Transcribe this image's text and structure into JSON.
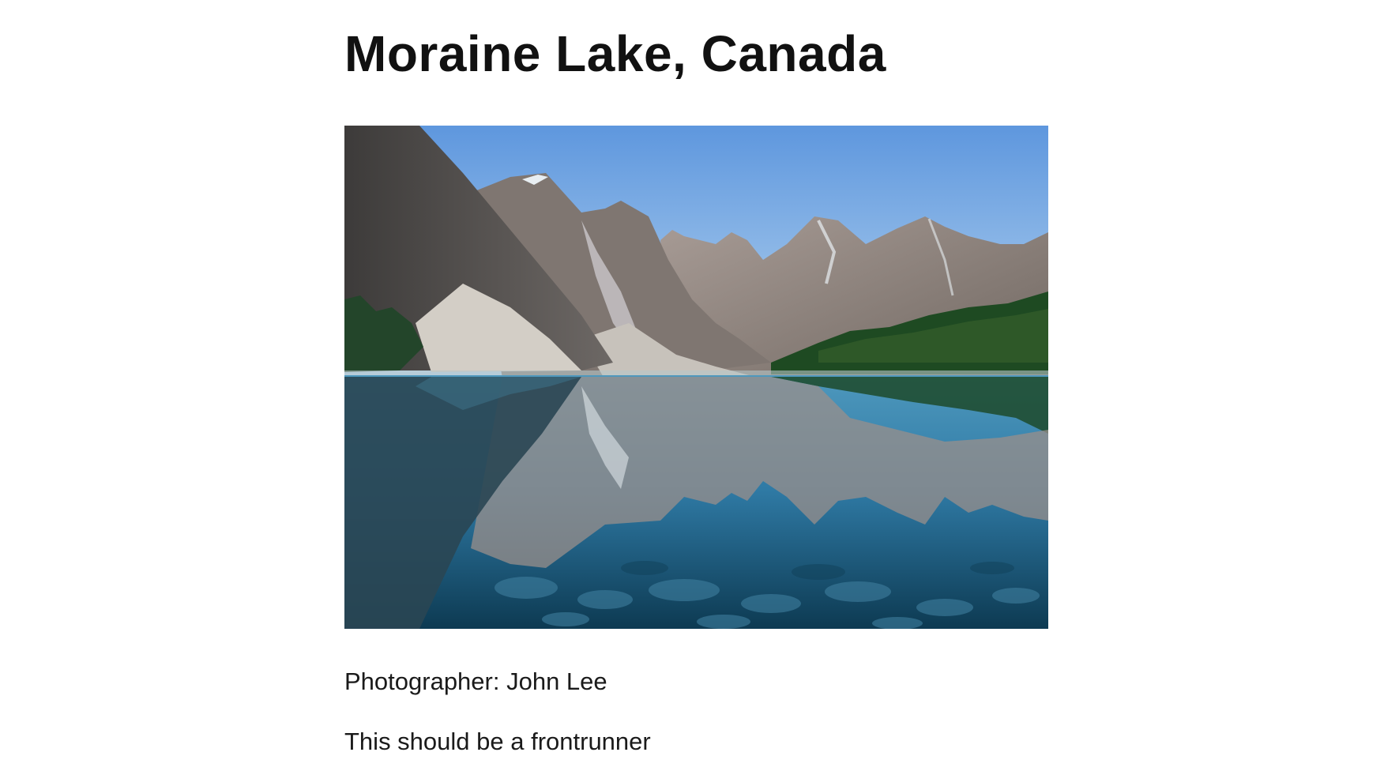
{
  "entry": {
    "title": "Moraine Lake, Canada",
    "photo": {
      "alt": "Moraine Lake, Canada",
      "subject": "mountains-reflected-in-lake"
    },
    "photographer_line": "Photographer: John Lee",
    "comment": "This should be a frontrunner"
  },
  "colors": {
    "sky_top": "#5e97de",
    "sky_bottom": "#b9d6ef",
    "lake_top": "#3f8fb5",
    "lake_bottom": "#0d3a52",
    "forest": "#1e4a22",
    "rock": "#8f7f74",
    "snow": "#e8eef2"
  }
}
